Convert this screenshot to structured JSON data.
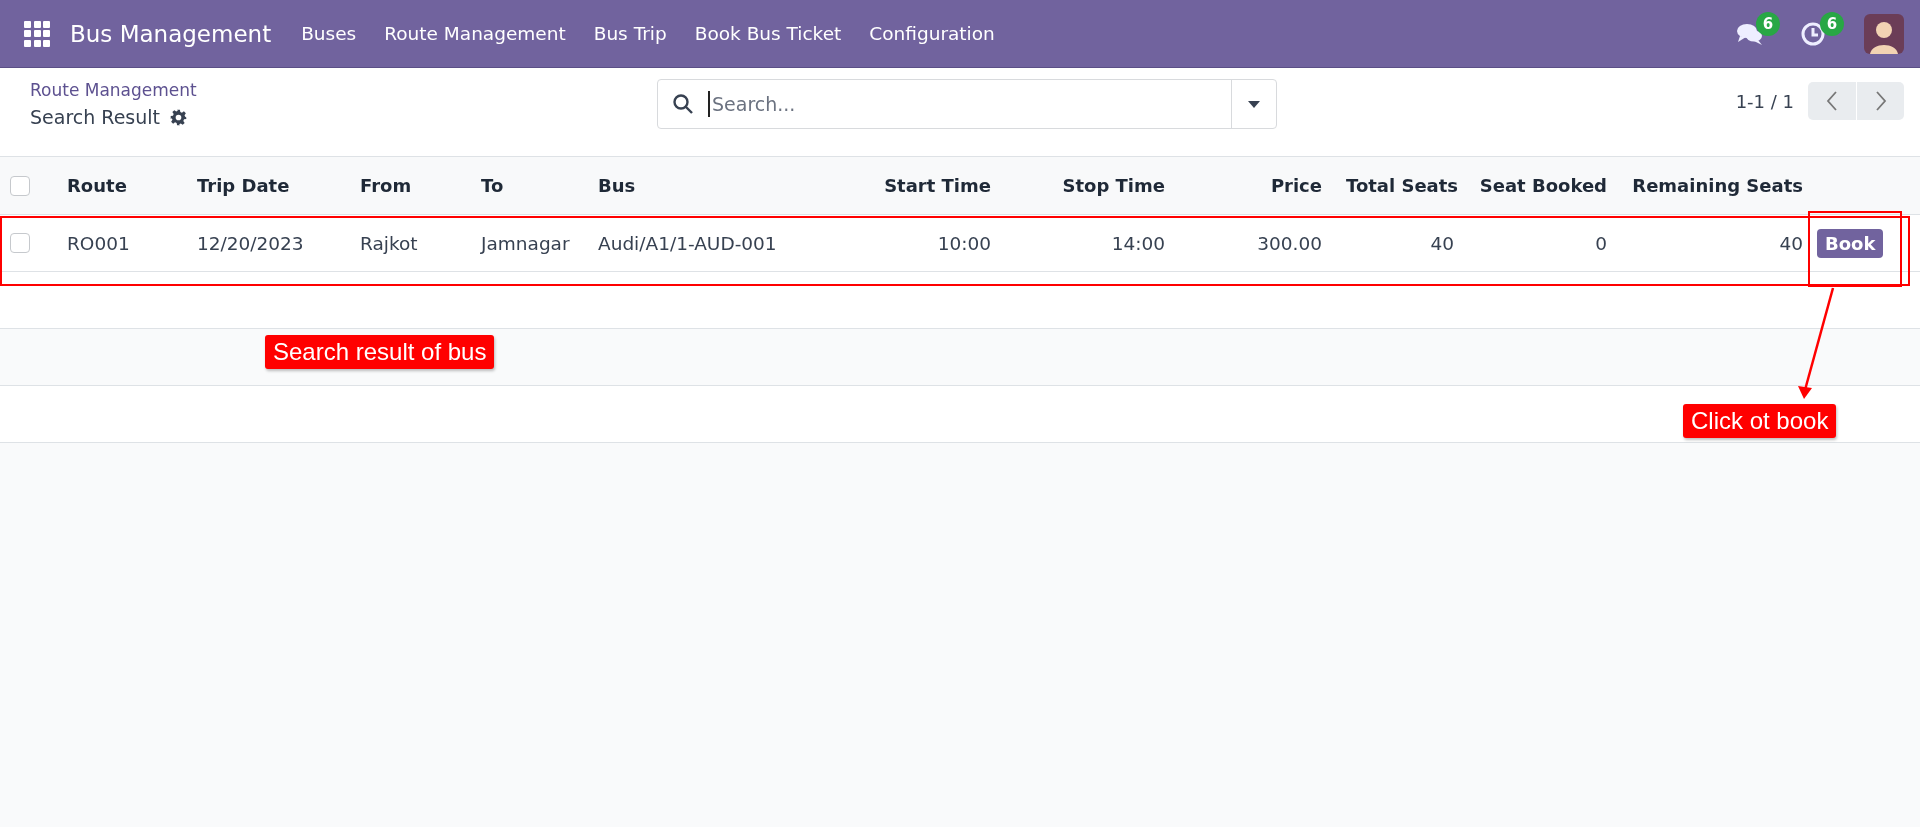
{
  "navbar": {
    "app_name": "Bus Management",
    "menu": [
      "Buses",
      "Route Management",
      "Bus Trip",
      "Book Bus Ticket",
      "Configuration"
    ],
    "messages_badge": "6",
    "activities_badge": "6"
  },
  "control_panel": {
    "breadcrumb": "Route Management",
    "title": "Search Result",
    "search": {
      "placeholder": "Search..."
    },
    "pager": "1-1 / 1"
  },
  "table": {
    "select_all": {
      "checked": false
    },
    "columns": [
      {
        "label": "Route",
        "kind": "text"
      },
      {
        "label": "Trip Date",
        "kind": "text"
      },
      {
        "label": "From",
        "kind": "text"
      },
      {
        "label": "To",
        "kind": "text"
      },
      {
        "label": "Bus",
        "kind": "text"
      },
      {
        "label": "Start Time",
        "kind": "number"
      },
      {
        "label": "Stop Time",
        "kind": "number"
      },
      {
        "label": "Price",
        "kind": "number"
      },
      {
        "label": "Total Seats",
        "kind": "number"
      },
      {
        "label": "Seat Booked",
        "kind": "number"
      },
      {
        "label": "Remaining Seats",
        "kind": "number"
      }
    ],
    "rows": [
      {
        "selected": false,
        "cells": [
          "RO001",
          "12/20/2023",
          "Rajkot",
          "Jamnagar",
          "Audi/A1/1-AUD-001",
          "10:00",
          "14:00",
          "300.00",
          "40",
          "0",
          "40"
        ],
        "action": "Book"
      }
    ]
  },
  "annotations": [
    {
      "kind": "label",
      "text": "Search result of bus"
    },
    {
      "kind": "label",
      "text": "Click ot book"
    }
  ]
}
